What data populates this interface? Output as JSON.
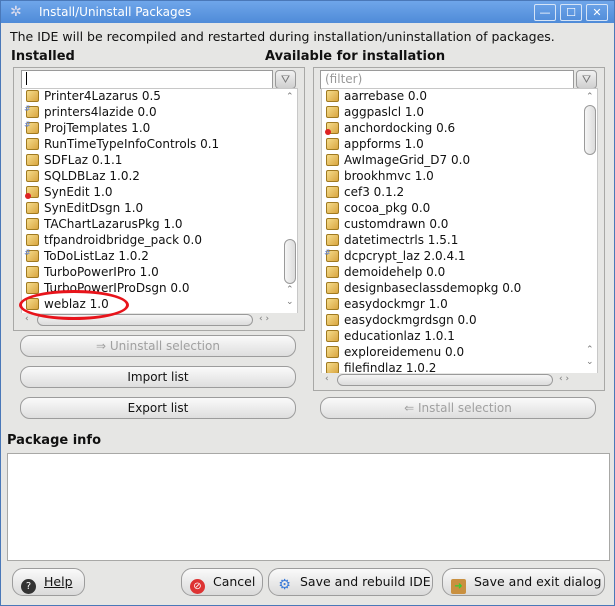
{
  "window": {
    "title": "Install/Uninstall Packages",
    "minimize": "—",
    "maximize": "☐",
    "close": "✕"
  },
  "message": "The IDE will be recompiled and restarted during installation/uninstallation of packages.",
  "installed": {
    "header": "Installed",
    "filter_value": "",
    "items": [
      {
        "label": "Printer4Lazarus 0.5",
        "icon": "package"
      },
      {
        "label": "printers4lazide 0.0",
        "icon": "package-design"
      },
      {
        "label": "ProjTemplates 1.0",
        "icon": "package-design"
      },
      {
        "label": "RunTimeTypeInfoControls 0.1",
        "icon": "package"
      },
      {
        "label": "SDFLaz 0.1.1",
        "icon": "package"
      },
      {
        "label": "SQLDBLaz 1.0.2",
        "icon": "package"
      },
      {
        "label": "SynEdit 1.0",
        "icon": "package-error"
      },
      {
        "label": "SynEditDsgn 1.0",
        "icon": "package"
      },
      {
        "label": "TAChartLazarusPkg 1.0",
        "icon": "package"
      },
      {
        "label": "tfpandroidbridge_pack 0.0",
        "icon": "package"
      },
      {
        "label": "ToDoListLaz 1.0.2",
        "icon": "package-design"
      },
      {
        "label": "TurboPowerIPro 1.0",
        "icon": "package"
      },
      {
        "label": "TurboPowerIProDsgn 0.0",
        "icon": "package"
      },
      {
        "label": "weblaz 1.0",
        "icon": "package",
        "highlighted": true
      }
    ],
    "uninstall_label": "⇒ Uninstall selection",
    "import_label": "Import list",
    "export_label": "Export list"
  },
  "available": {
    "header": "Available for installation",
    "filter_placeholder": "(filter)",
    "items": [
      {
        "label": "aarrebase 0.0",
        "icon": "package"
      },
      {
        "label": "aggpaslcl 1.0",
        "icon": "package"
      },
      {
        "label": "anchordocking 0.6",
        "icon": "package-error"
      },
      {
        "label": "appforms 1.0",
        "icon": "package"
      },
      {
        "label": "AwImageGrid_D7 0.0",
        "icon": "package"
      },
      {
        "label": "brookhmvc 1.0",
        "icon": "package"
      },
      {
        "label": "cef3 0.1.2",
        "icon": "package"
      },
      {
        "label": "cocoa_pkg 0.0",
        "icon": "package"
      },
      {
        "label": "customdrawn 0.0",
        "icon": "package"
      },
      {
        "label": "datetimectrls 1.5.1",
        "icon": "package"
      },
      {
        "label": "dcpcrypt_laz 2.0.4.1",
        "icon": "package-design"
      },
      {
        "label": "demoidehelp 0.0",
        "icon": "package"
      },
      {
        "label": "designbaseclassdemopkg 0.0",
        "icon": "package"
      },
      {
        "label": "easydockmgr 1.0",
        "icon": "package"
      },
      {
        "label": "easydockmgrdsgn 0.0",
        "icon": "package"
      },
      {
        "label": "educationlaz 1.0.1",
        "icon": "package"
      },
      {
        "label": "exploreidemenu 0.0",
        "icon": "package"
      },
      {
        "label": "filefindlaz 1.0.2",
        "icon": "package"
      }
    ],
    "install_label": "⇐ Install selection"
  },
  "package_info": {
    "header": "Package info",
    "text": ""
  },
  "buttons": {
    "help": "Help",
    "cancel": "Cancel",
    "save_rebuild": "Save and rebuild IDE",
    "save_exit": "Save and exit dialog"
  },
  "colors": {
    "titlebar": "#5b95dc",
    "highlight_ellipse": "#e8141b"
  }
}
